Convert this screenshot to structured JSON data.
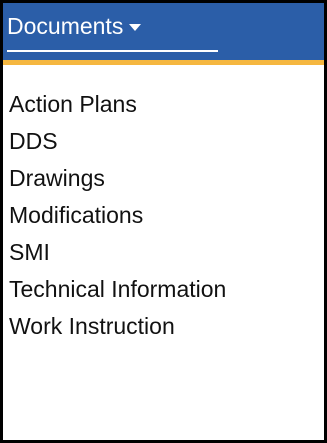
{
  "menu": {
    "title": "Documents",
    "items": [
      {
        "id": "action-plans",
        "label": "Action Plans"
      },
      {
        "id": "dds",
        "label": "DDS"
      },
      {
        "id": "drawings",
        "label": "Drawings"
      },
      {
        "id": "modifications",
        "label": "Modifications"
      },
      {
        "id": "smi",
        "label": "SMI"
      },
      {
        "id": "technical-information",
        "label": "Technical Information"
      },
      {
        "id": "work-instruction",
        "label": "Work Instruction"
      }
    ]
  },
  "colors": {
    "header_bg": "#2b5ea8",
    "accent": "#f5b740",
    "text": "#111111"
  },
  "icons": {
    "dropdown": "caret-down-icon"
  }
}
